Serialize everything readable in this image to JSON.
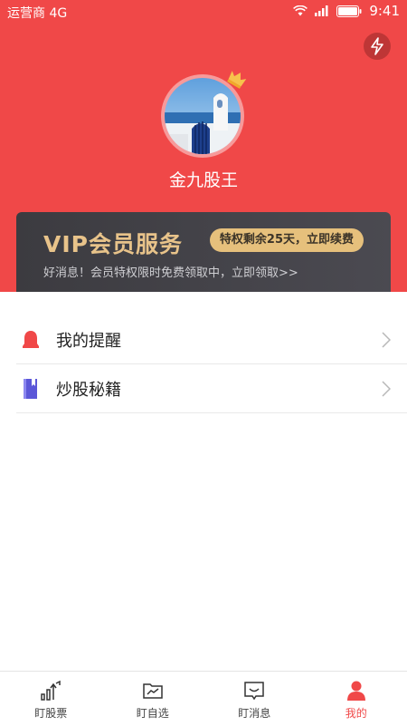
{
  "status_bar": {
    "carrier": "运营商 4G",
    "time": "9:41"
  },
  "profile": {
    "username": "金九股王"
  },
  "vip": {
    "title": "VIP会员服务",
    "badge": "特权剩余25天，立即续费",
    "subtitle": "好消息！会员特权限时免费领取中，立即领取>>"
  },
  "menu": {
    "items": [
      {
        "label": "我的提醒",
        "icon": "bell-icon"
      },
      {
        "label": "炒股秘籍",
        "icon": "book-icon"
      }
    ]
  },
  "tabbar": {
    "items": [
      {
        "label": "盯股票",
        "icon": "stock-chart-icon"
      },
      {
        "label": "盯自选",
        "icon": "watchlist-folder-icon"
      },
      {
        "label": "盯消息",
        "icon": "message-icon"
      },
      {
        "label": "我的",
        "icon": "user-icon"
      }
    ],
    "active_index": 3
  },
  "colors": {
    "brand_red": "#f04848",
    "vip_gold": "#e8c38a",
    "vip_dark": "#3c3b40"
  }
}
